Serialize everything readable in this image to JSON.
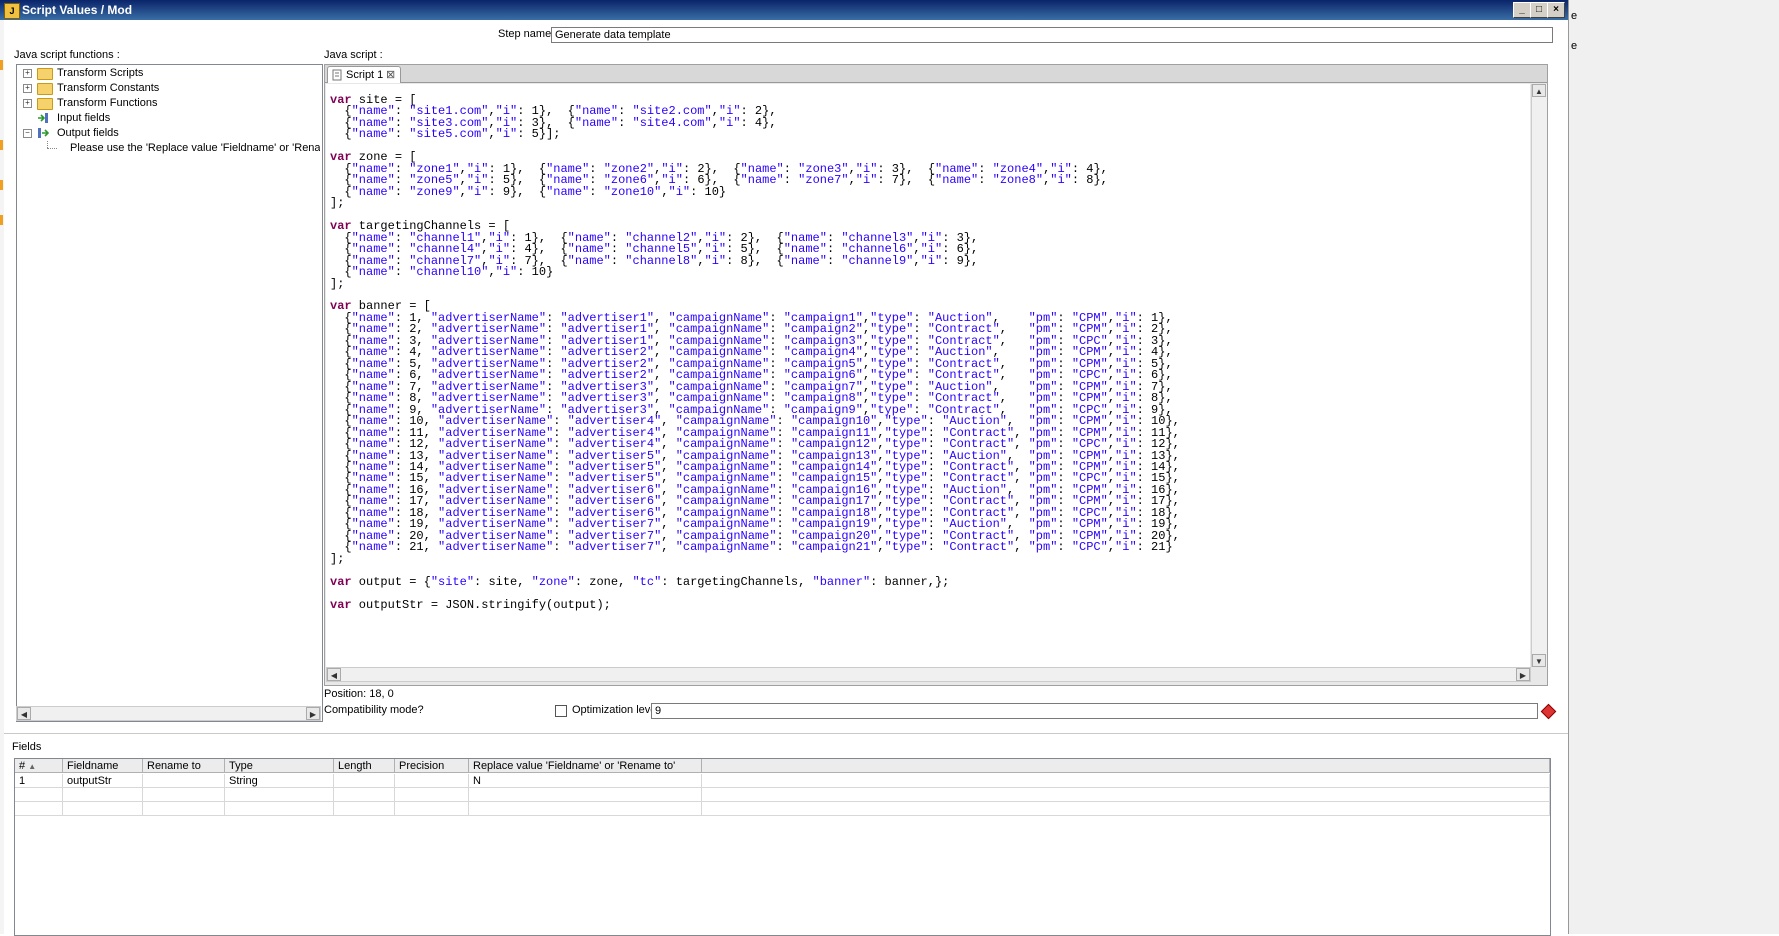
{
  "window": {
    "title": "Script Values / Mod"
  },
  "step_name": {
    "label": "Step name",
    "value": "Generate data template"
  },
  "left_panel": {
    "label": "Java script functions :",
    "tree": [
      {
        "label": "Transform Scripts"
      },
      {
        "label": "Transform Constants"
      },
      {
        "label": "Transform Functions"
      },
      {
        "label": "Input fields"
      },
      {
        "label": "Output fields"
      },
      {
        "label": "Please use the 'Replace value 'Fieldname' or 'Rename To' fie"
      }
    ]
  },
  "editor": {
    "label": "Java script :",
    "tab_label": "Script 1",
    "code_lines": [
      "var site = [",
      "  {\"name\": \"site1.com\",\"i\": 1},  {\"name\": \"site2.com\",\"i\": 2},",
      "  {\"name\": \"site3.com\",\"i\": 3},  {\"name\": \"site4.com\",\"i\": 4},",
      "  {\"name\": \"site5.com\",\"i\": 5}];",
      "",
      "var zone = [",
      "  {\"name\": \"zone1\",\"i\": 1},  {\"name\": \"zone2\",\"i\": 2},  {\"name\": \"zone3\",\"i\": 3},  {\"name\": \"zone4\",\"i\": 4},",
      "  {\"name\": \"zone5\",\"i\": 5},  {\"name\": \"zone6\",\"i\": 6},  {\"name\": \"zone7\",\"i\": 7},  {\"name\": \"zone8\",\"i\": 8},",
      "  {\"name\": \"zone9\",\"i\": 9},  {\"name\": \"zone10\",\"i\": 10}",
      "];",
      "",
      "var targetingChannels = [",
      "  {\"name\": \"channel1\",\"i\": 1},  {\"name\": \"channel2\",\"i\": 2},  {\"name\": \"channel3\",\"i\": 3},",
      "  {\"name\": \"channel4\",\"i\": 4},  {\"name\": \"channel5\",\"i\": 5},  {\"name\": \"channel6\",\"i\": 6},",
      "  {\"name\": \"channel7\",\"i\": 7},  {\"name\": \"channel8\",\"i\": 8},  {\"name\": \"channel9\",\"i\": 9},",
      "  {\"name\": \"channel10\",\"i\": 10}",
      "];",
      "",
      "var banner = [",
      "  {\"name\": 1, \"advertiserName\": \"advertiser1\", \"campaignName\": \"campaign1\",\"type\": \"Auction\",    \"pm\": \"CPM\",\"i\": 1},",
      "  {\"name\": 2, \"advertiserName\": \"advertiser1\", \"campaignName\": \"campaign2\",\"type\": \"Contract\",   \"pm\": \"CPM\",\"i\": 2},",
      "  {\"name\": 3, \"advertiserName\": \"advertiser1\", \"campaignName\": \"campaign3\",\"type\": \"Contract\",   \"pm\": \"CPC\",\"i\": 3},",
      "  {\"name\": 4, \"advertiserName\": \"advertiser2\", \"campaignName\": \"campaign4\",\"type\": \"Auction\",    \"pm\": \"CPM\",\"i\": 4},",
      "  {\"name\": 5, \"advertiserName\": \"advertiser2\", \"campaignName\": \"campaign5\",\"type\": \"Contract\",   \"pm\": \"CPM\",\"i\": 5},",
      "  {\"name\": 6, \"advertiserName\": \"advertiser2\", \"campaignName\": \"campaign6\",\"type\": \"Contract\",   \"pm\": \"CPC\",\"i\": 6},",
      "  {\"name\": 7, \"advertiserName\": \"advertiser3\", \"campaignName\": \"campaign7\",\"type\": \"Auction\",    \"pm\": \"CPM\",\"i\": 7},",
      "  {\"name\": 8, \"advertiserName\": \"advertiser3\", \"campaignName\": \"campaign8\",\"type\": \"Contract\",   \"pm\": \"CPM\",\"i\": 8},",
      "  {\"name\": 9, \"advertiserName\": \"advertiser3\", \"campaignName\": \"campaign9\",\"type\": \"Contract\",   \"pm\": \"CPC\",\"i\": 9},",
      "  {\"name\": 10, \"advertiserName\": \"advertiser4\", \"campaignName\": \"campaign10\",\"type\": \"Auction\",  \"pm\": \"CPM\",\"i\": 10},",
      "  {\"name\": 11, \"advertiserName\": \"advertiser4\", \"campaignName\": \"campaign11\",\"type\": \"Contract\", \"pm\": \"CPM\",\"i\": 11},",
      "  {\"name\": 12, \"advertiserName\": \"advertiser4\", \"campaignName\": \"campaign12\",\"type\": \"Contract\", \"pm\": \"CPC\",\"i\": 12},",
      "  {\"name\": 13, \"advertiserName\": \"advertiser5\", \"campaignName\": \"campaign13\",\"type\": \"Auction\",  \"pm\": \"CPM\",\"i\": 13},",
      "  {\"name\": 14, \"advertiserName\": \"advertiser5\", \"campaignName\": \"campaign14\",\"type\": \"Contract\", \"pm\": \"CPM\",\"i\": 14},",
      "  {\"name\": 15, \"advertiserName\": \"advertiser5\", \"campaignName\": \"campaign15\",\"type\": \"Contract\", \"pm\": \"CPC\",\"i\": 15},",
      "  {\"name\": 16, \"advertiserName\": \"advertiser6\", \"campaignName\": \"campaign16\",\"type\": \"Auction\",  \"pm\": \"CPM\",\"i\": 16},",
      "  {\"name\": 17, \"advertiserName\": \"advertiser6\", \"campaignName\": \"campaign17\",\"type\": \"Contract\", \"pm\": \"CPM\",\"i\": 17},",
      "  {\"name\": 18, \"advertiserName\": \"advertiser6\", \"campaignName\": \"campaign18\",\"type\": \"Contract\", \"pm\": \"CPC\",\"i\": 18},",
      "  {\"name\": 19, \"advertiserName\": \"advertiser7\", \"campaignName\": \"campaign19\",\"type\": \"Auction\",  \"pm\": \"CPM\",\"i\": 19},",
      "  {\"name\": 20, \"advertiserName\": \"advertiser7\", \"campaignName\": \"campaign20\",\"type\": \"Contract\", \"pm\": \"CPM\",\"i\": 20},",
      "  {\"name\": 21, \"advertiserName\": \"advertiser7\", \"campaignName\": \"campaign21\",\"type\": \"Contract\", \"pm\": \"CPC\",\"i\": 21}",
      "];",
      "",
      "var output = {\"site\": site, \"zone\": zone, \"tc\": targetingChannels, \"banner\": banner,};",
      "",
      "var outputStr = JSON.stringify(output);"
    ]
  },
  "status": {
    "position": "Position: 18, 0",
    "compatibility_label": "Compatibility mode?",
    "compatibility_checked": false,
    "optimization_label": "Optimization level",
    "optimization_value": "9"
  },
  "fields": {
    "label": "Fields",
    "columns": [
      "#",
      "Fieldname",
      "Rename to",
      "Type",
      "Length",
      "Precision",
      "Replace value 'Fieldname' or 'Rename to'"
    ],
    "rows": [
      [
        "1",
        "outputStr",
        "",
        "String",
        "",
        "",
        "N"
      ]
    ]
  },
  "right_strip": {
    "chars": [
      "e",
      "e"
    ]
  },
  "colors": {
    "titlebar": "#0a246a",
    "keyword": "#7f0055",
    "string": "#2a00ff"
  }
}
